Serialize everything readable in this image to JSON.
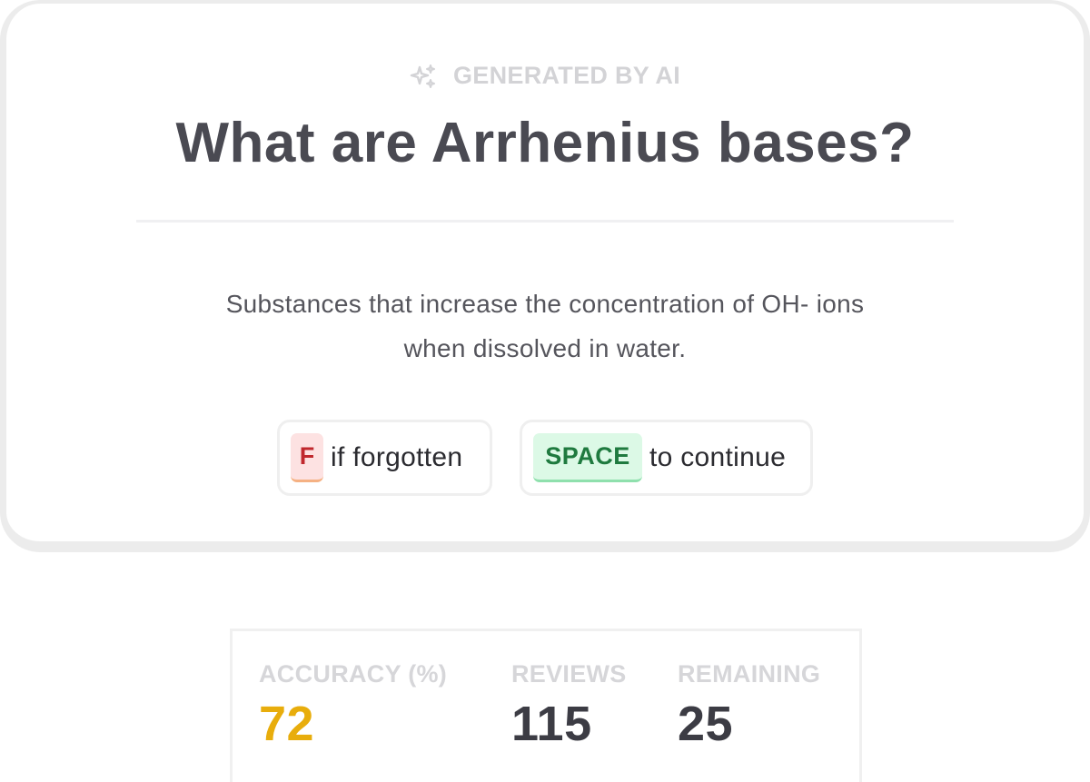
{
  "card": {
    "tag_icon": "sparkles-icon",
    "tag_label": "GENERATED BY AI",
    "question": "What are Arrhenius bases?",
    "answer": "Substances that increase the concentration of OH- ions when dissolved in water."
  },
  "hints": {
    "forgot_key": "F",
    "forgot_text": "if forgotten",
    "continue_key": "SPACE",
    "continue_text": "to continue"
  },
  "stats": {
    "accuracy_label": "ACCURACY (%)",
    "accuracy_value": "72",
    "reviews_label": "REVIEWS",
    "reviews_value": "115",
    "remaining_label": "REMAINING",
    "remaining_value": "25"
  },
  "colors": {
    "accuracy": "#e8ad0c",
    "forgot_key_bg": "#fde2e2",
    "forgot_key_text": "#c0282d",
    "continue_key_bg": "#dcf9e6",
    "continue_key_text": "#1f7a3f"
  }
}
